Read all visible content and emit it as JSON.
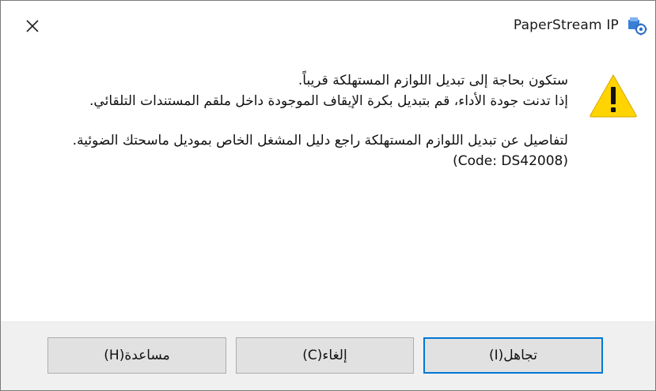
{
  "window": {
    "title": "PaperStream IP",
    "close_label": "✕",
    "app_icon": "paperstream-scanner-icon"
  },
  "message": {
    "line1": "ستكون بحاجة إلى تبديل اللوازم المستهلكة قريباً.",
    "line2": "إذا تدنت جودة الأداء، قم بتبديل بكرة الإيقاف الموجودة داخل ملقم المستندات التلقائي.",
    "line3": "لتفاصيل عن تبديل اللوازم المستهلكة راجع دليل المشغل الخاص بموديل ماسحتك الضوئية.",
    "code": "(Code: DS42008)",
    "icon": "warning-icon"
  },
  "buttons": {
    "ignore_label": "تجاهل(I)",
    "cancel_label": "إلغاء(C)",
    "help_label": "مساعدة(H)"
  },
  "colors": {
    "warning_fill": "#ffd400",
    "primary_border": "#0078d7",
    "footer_bg": "#f0f0f0",
    "button_bg": "#e1e1e1"
  }
}
